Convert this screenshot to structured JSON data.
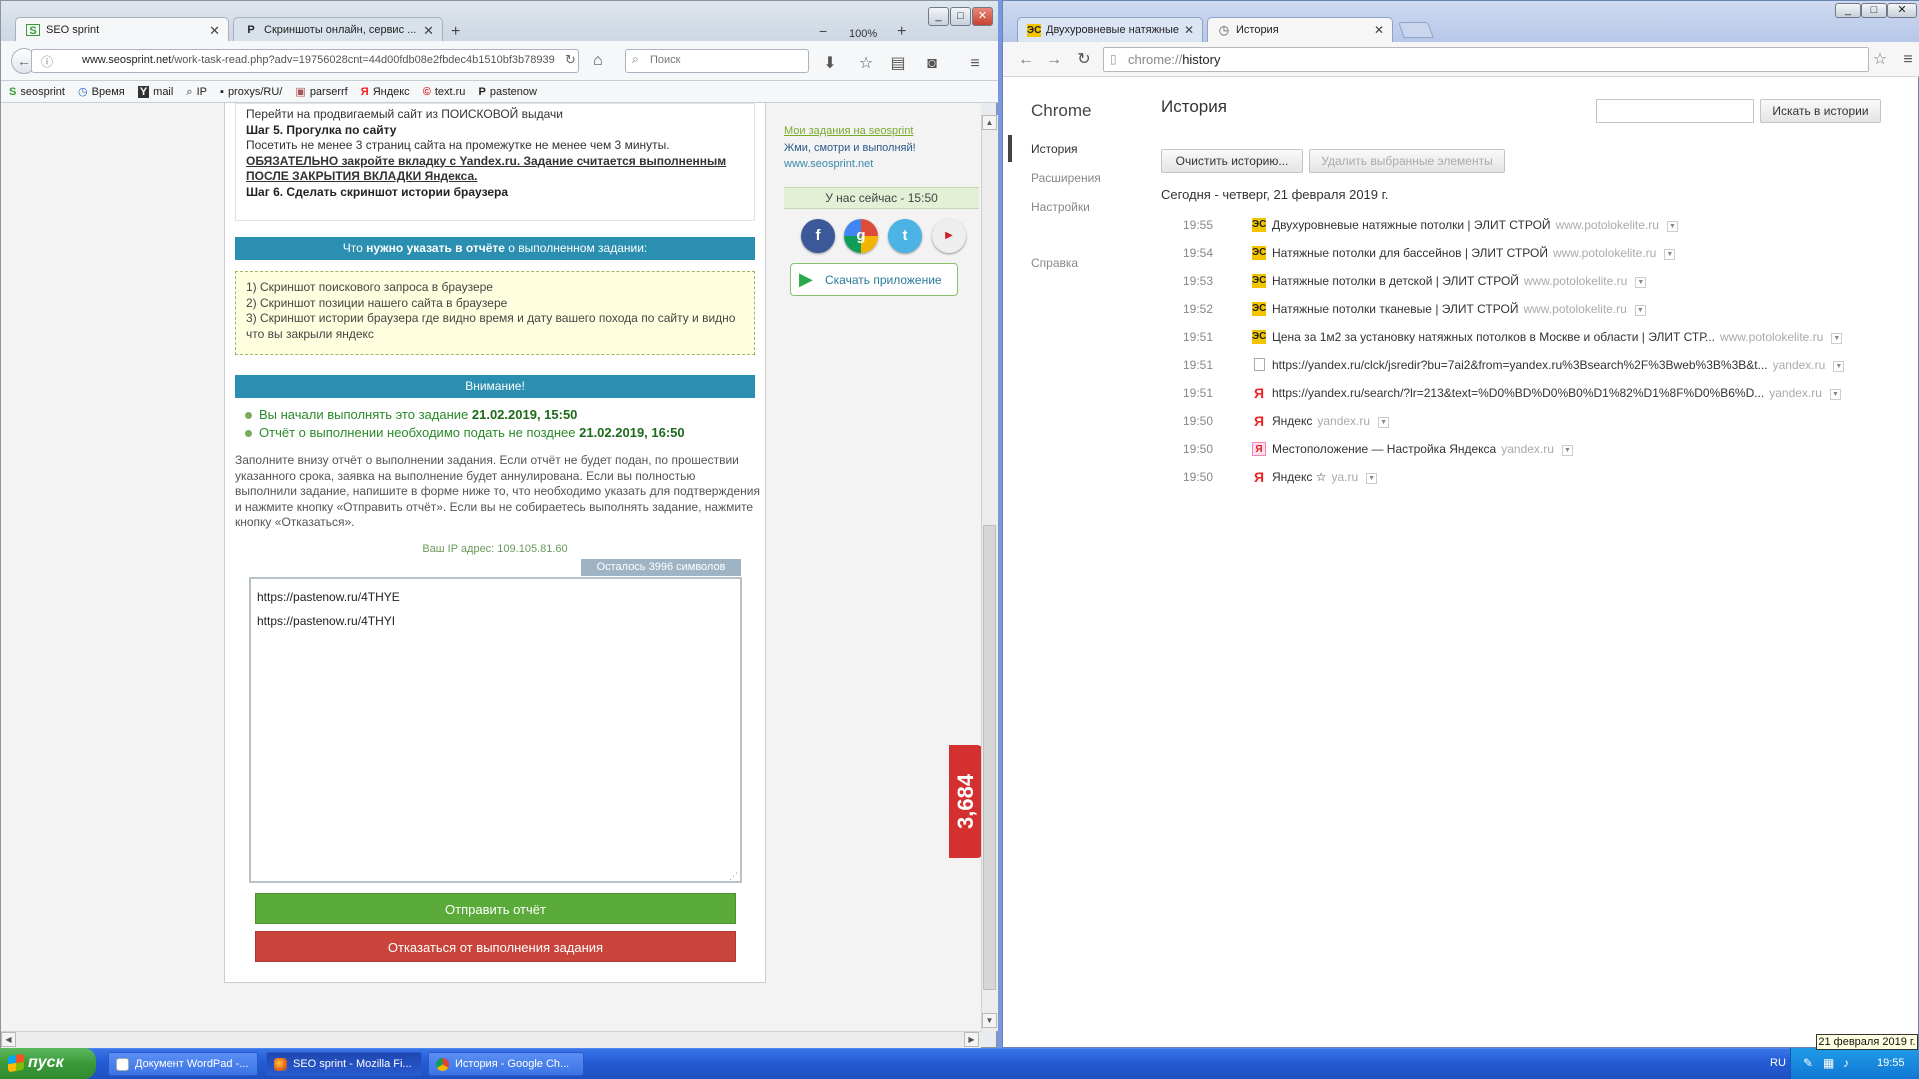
{
  "firefox": {
    "tabs": [
      {
        "label": "SEO sprint",
        "favicon": "S"
      },
      {
        "label": "Скриншоты онлайн, сервис ...",
        "favicon": "P"
      }
    ],
    "zoom": "100%",
    "url_domain": "www.seosprint.net",
    "url_rest": "/work-task-read.php?adv=19756028cnt=44d00fdb08e2fbdec4b1510bf3b78939",
    "search_placeholder": "Поиск",
    "bookmarks": [
      {
        "label": "seosprint",
        "icon": "S"
      },
      {
        "label": "Время",
        "icon": "◷"
      },
      {
        "label": "mail",
        "icon": "Y"
      },
      {
        "label": "IP",
        "icon": "⌕"
      },
      {
        "label": "proxys/RU/",
        "icon": "▪"
      },
      {
        "label": "parserrf",
        "icon": "▣"
      },
      {
        "label": "Яндекс",
        "icon": "Я"
      },
      {
        "label": "text.ru",
        "icon": "©"
      },
      {
        "label": "pastenow",
        "icon": "P"
      }
    ],
    "steps": {
      "line1": "Перейти на продвигаемый сайт из ПОИСКОВОЙ выдачи",
      "step5_title": "Шаг 5. Прогулка по сайту",
      "step5_text": "Посетить не менее 3 страниц сайта на промежутке не менее чем 3 минуты.",
      "step5_warning": "ОБЯЗАТЕЛЬНО закройте вкладку с Yandex.ru. Задание считается выполненным ПОСЛЕ ЗАКРЫТИЯ ВКЛАДКИ Яндекса.",
      "step6_title": "Шаг 6. Сделать скриншот истории браузера"
    },
    "report_header_pre": "Что ",
    "report_header_bold": "нужно указать в отчёте",
    "report_header_post": " о выполненном задании:",
    "report_items": [
      "1) Скриншот поискового запроса в браузере",
      "2) Скриншот позиции нашего сайта в браузере",
      "3) Скриншот истории браузера где видно время и дату вашего похода по сайту и видно что вы закрыли яндекс"
    ],
    "attention": "Внимание!",
    "started_text": "Вы начали выполнять это задание ",
    "started_time": "21.02.2019, 15:50",
    "deadline_text": "Отчёт о выполнении необходимо подать не позднее ",
    "deadline_time": "21.02.2019, 16:50",
    "instructions": "Заполните внизу отчёт о выполнении задания. Если отчёт не будет подан, по прошествии указанного срока, заявка на выполнение будет аннулирована. Если вы полностью выполнили задание, напишите в форме ниже то, что необходимо указать для подтверждения и нажмите кнопку «Отправить отчёт». Если вы не собираетесь выполнять задание, нажмите кнопку «Отказаться».",
    "ip_text": "Ваш IP адрес: 109.105.81.60",
    "remaining": "Осталось 3996 символов",
    "report_lines": [
      "https://pastenow.ru/4THYE",
      "https://pastenow.ru/4THYI"
    ],
    "submit_label": "Отправить отчёт",
    "decline_label": "Отказаться от выполнения задания",
    "sidebar": {
      "my_tasks": "Мои задания на seosprint",
      "slogan": "Жми, смотри и выполняй!",
      "site": "www.seosprint.net",
      "online": "У нас сейчас - 15:50",
      "download_app": "Скачать приложение"
    },
    "counter": "3,684",
    "colors": {
      "blue_header": "#2a8fb0",
      "submit": "#5aab3a",
      "decline": "#c9443a"
    }
  },
  "chrome": {
    "tabs": [
      {
        "label": "Двухуровневые натяжные",
        "favicon": "ЭС"
      },
      {
        "label": "История",
        "favicon": "◷"
      }
    ],
    "url_scheme": "chrome://",
    "url_path": "history",
    "brand": "Chrome",
    "nav": [
      "История",
      "Расширения",
      "Настройки",
      "Справка"
    ],
    "title": "История",
    "search_button": "Искать в истории",
    "clear_button": "Очистить историю...",
    "delete_button": "Удалить выбранные элементы",
    "day_header": "Сегодня - четверг, 21 февраля 2019 г.",
    "entries": [
      {
        "time": "19:55",
        "icon": "es",
        "title": "Двухуровневые натяжные потолки | ЭЛИТ СТРОЙ",
        "domain": "www.potolokelite.ru"
      },
      {
        "time": "19:54",
        "icon": "es",
        "title": "Натяжные потолки для бассейнов | ЭЛИТ СТРОЙ",
        "domain": "www.potolokelite.ru"
      },
      {
        "time": "19:53",
        "icon": "es",
        "title": "Натяжные потолки в детской | ЭЛИТ СТРОЙ",
        "domain": "www.potolokelite.ru"
      },
      {
        "time": "19:52",
        "icon": "es",
        "title": "Натяжные потолки тканевые | ЭЛИТ СТРОЙ",
        "domain": "www.potolokelite.ru"
      },
      {
        "time": "19:51",
        "icon": "es",
        "title": "Цена за 1м2 за установку натяжных потолков в Москве и области | ЭЛИТ СТР...",
        "domain": "www.potolokelite.ru"
      },
      {
        "time": "19:51",
        "icon": "doc",
        "title": "https://yandex.ru/clck/jsredir?bu=7ai2&from=yandex.ru%3Bsearch%2F%3Bweb%3B%3B&t...",
        "domain": "yandex.ru"
      },
      {
        "time": "19:51",
        "icon": "ya",
        "title": "https://yandex.ru/search/?lr=213&text=%D0%BD%D0%B0%D1%82%D1%8F%D0%B6%D...",
        "domain": "yandex.ru"
      },
      {
        "time": "19:50",
        "icon": "ya",
        "title": "Яндекс",
        "domain": "yandex.ru"
      },
      {
        "time": "19:50",
        "icon": "yi",
        "title": "Местоположение — Настройка Яндекса",
        "domain": "yandex.ru"
      },
      {
        "time": "19:50",
        "icon": "ya",
        "title": "Яндекс ☆",
        "domain": "ya.ru"
      }
    ]
  },
  "taskbar": {
    "start": "пуск",
    "tasks": [
      {
        "label": "Документ WordPad -..."
      },
      {
        "label": "SEO sprint - Mozilla Fi..."
      },
      {
        "label": "История - Google Ch..."
      }
    ],
    "lang": "RU",
    "clock": "19:55",
    "tooltip": "21 февраля 2019 г."
  }
}
